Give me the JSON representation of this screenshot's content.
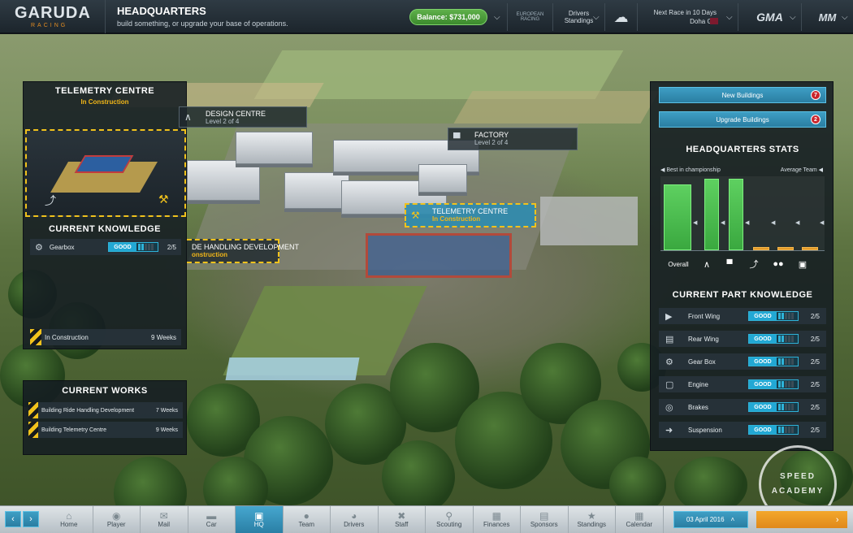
{
  "topbar": {
    "logo": "GARUDA",
    "logo_sub": "RACING",
    "title": "HEADQUARTERS",
    "subtitle": "build something, or upgrade your base of operations.",
    "balance": "Balance: $731,000",
    "series_logo": "EUROPEAN RACING",
    "drivers_standings_1": "Drivers",
    "drivers_standings_2": "Standings",
    "next_race_label": "Next Race in 10 Days",
    "next_race_name": "Doha GP",
    "brand1": "GMA",
    "brand2": "MM"
  },
  "telemetry": {
    "title": "TELEMETRY CENTRE",
    "status": "In Construction",
    "knowledge_title": "CURRENT KNOWLEDGE",
    "knowledge_item": "Gearbox",
    "knowledge_rating": "GOOD",
    "knowledge_value": "2/5",
    "construction_label": "In Construction",
    "construction_time": "9 Weeks"
  },
  "works": {
    "title": "CURRENT WORKS",
    "items": [
      {
        "label": "Building Ride Handling Development",
        "time": "7 Weeks"
      },
      {
        "label": "Building Telemetry Centre",
        "time": "9 Weeks"
      }
    ]
  },
  "map_labels": {
    "design_name": "DESIGN CENTRE",
    "design_level": "Level 2 of 4",
    "factory_name": "FACTORY",
    "factory_level": "Level 2 of 4",
    "telemetry_name": "TELEMETRY CENTRE",
    "telemetry_status": "In Construction",
    "ride_name": "DE HANDLING DEVELOPMENT",
    "ride_status": "onstruction"
  },
  "right": {
    "new_buildings": "New Buildings",
    "new_count": "7",
    "upgrade_buildings": "Upgrade Buildings",
    "upgrade_count": "2",
    "stats_title": "HEADQUARTERS STATS",
    "legend_left": "Best in championship",
    "legend_right": "Average Team",
    "overall": "Overall",
    "part_title": "CURRENT PART KNOWLEDGE",
    "parts": [
      {
        "name": "Front Wing",
        "rating": "GOOD",
        "value": "2/5",
        "icon": "front-wing-icon"
      },
      {
        "name": "Rear Wing",
        "rating": "GOOD",
        "value": "2/5",
        "icon": "rear-wing-icon"
      },
      {
        "name": "Gear Box",
        "rating": "GOOD",
        "value": "2/5",
        "icon": "gear-icon"
      },
      {
        "name": "Engine",
        "rating": "GOOD",
        "value": "2/5",
        "icon": "engine-icon"
      },
      {
        "name": "Brakes",
        "rating": "GOOD",
        "value": "2/5",
        "icon": "brake-icon"
      },
      {
        "name": "Suspension",
        "rating": "GOOD",
        "value": "2/5",
        "icon": "suspension-icon"
      }
    ]
  },
  "stats_bars": [
    {
      "level": 0.92,
      "low": false
    },
    {
      "level": 1.0,
      "low": false
    },
    {
      "level": 1.0,
      "low": false
    },
    {
      "level": 0.05,
      "low": true
    },
    {
      "level": 0.05,
      "low": true
    },
    {
      "level": 0.05,
      "low": true
    }
  ],
  "bottombar": {
    "items": [
      {
        "label": "Home",
        "icon": "home-icon"
      },
      {
        "label": "Player",
        "icon": "player-icon"
      },
      {
        "label": "Mail",
        "icon": "mail-icon"
      },
      {
        "label": "Car",
        "icon": "car-icon"
      },
      {
        "label": "HQ",
        "icon": "hq-icon"
      },
      {
        "label": "Team",
        "icon": "team-icon"
      },
      {
        "label": "Drivers",
        "icon": "helmet-icon"
      },
      {
        "label": "Staff",
        "icon": "staff-icon"
      },
      {
        "label": "Scouting",
        "icon": "magnifier-icon"
      },
      {
        "label": "Finances",
        "icon": "finances-icon"
      },
      {
        "label": "Sponsors",
        "icon": "sponsors-icon"
      },
      {
        "label": "Standings",
        "icon": "trophy-icon"
      },
      {
        "label": "Calendar",
        "icon": "calendar-icon"
      }
    ],
    "date": "03 April 2016"
  },
  "watermark": "SPEED ACADEMY"
}
